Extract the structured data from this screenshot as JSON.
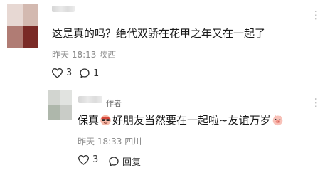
{
  "comment": {
    "username": "",
    "text": "这是真的吗？绝代双骄在花甲之年又在一起了",
    "time": "昨天 18:13",
    "location": "陕西",
    "like_count": "3",
    "reply_count": "1"
  },
  "reply": {
    "username": "",
    "author_badge": "作者",
    "text_part1": "保真",
    "emoji1": "sunglasses-emoji",
    "text_part2": "好朋友当然要在一起啦~友谊万岁",
    "emoji2": "pig-emoji",
    "time": "昨天 18:33",
    "location": "四川",
    "like_count": "3",
    "reply_label": "回复"
  }
}
